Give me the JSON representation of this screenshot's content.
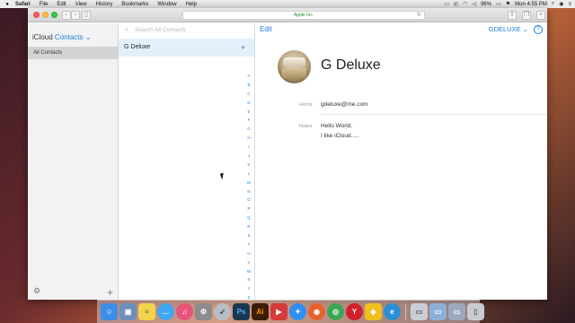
{
  "menubar": {
    "app": "Safari",
    "menus": [
      "File",
      "Edit",
      "View",
      "History",
      "Bookmarks",
      "Window",
      "Help"
    ],
    "battery": "96%",
    "clock": "Mon 4:55 PM"
  },
  "browser": {
    "url": "Apple Inc."
  },
  "sidebar": {
    "app_name_prefix": "iCloud",
    "app_name": "Contacts",
    "group": "All Contacts"
  },
  "list": {
    "search_placeholder": "Search All Contacts",
    "contacts": [
      {
        "name": "G Deluxe"
      }
    ],
    "index": [
      "A",
      "B",
      "C",
      "D",
      "E",
      "F",
      "G",
      "H",
      "I",
      "J",
      "K",
      "L",
      "M",
      "N",
      "O",
      "P",
      "Q",
      "R",
      "S",
      "T",
      "U",
      "V",
      "W",
      "X",
      "Y",
      "Z",
      "#"
    ]
  },
  "detail": {
    "edit_label": "Edit",
    "account": "GDELUXE",
    "help": "?",
    "name": "G Deluxe",
    "fields": [
      {
        "label": "Home",
        "value": "gdeluxe@me.com"
      },
      {
        "label": "Notes",
        "value": "Hello World."
      },
      {
        "label": "",
        "value": "I like iCloud....."
      }
    ]
  },
  "dock": {
    "apps": [
      {
        "icon": "finder-icon",
        "glyph": "☺",
        "color": "#3d8ee8"
      },
      {
        "icon": "preview-icon",
        "glyph": "▣",
        "color": "#6f8fb8"
      },
      {
        "icon": "notes-icon",
        "glyph": "≡",
        "color": "#f3d44e"
      },
      {
        "icon": "messages-icon",
        "glyph": "…",
        "color": "#3fa6f0"
      },
      {
        "icon": "itunes-icon",
        "glyph": "♫",
        "color": "#e9547a"
      },
      {
        "icon": "system-preferences-icon",
        "glyph": "⚙",
        "color": "#8c8c8c"
      },
      {
        "icon": "launchpad-icon",
        "glyph": "➶",
        "color": "#b9bec6"
      },
      {
        "icon": "photoshop-icon",
        "glyph": "Ps",
        "color": "#1b3651"
      },
      {
        "icon": "illustrator-icon",
        "glyph": "Ai",
        "color": "#ff7c00"
      },
      {
        "icon": "video-player-icon",
        "glyph": "▶",
        "color": "#d63a3a"
      },
      {
        "icon": "safari-icon",
        "glyph": "✦",
        "color": "#2e8ff0"
      },
      {
        "icon": "firefox-icon",
        "glyph": "◉",
        "color": "#e8612c"
      },
      {
        "icon": "chrome-icon",
        "glyph": "◎",
        "color": "#3aa757"
      },
      {
        "icon": "yandex-icon",
        "glyph": "Y",
        "color": "#d21f2d"
      },
      {
        "icon": "duck-icon",
        "glyph": "◆",
        "color": "#f0c020"
      },
      {
        "icon": "edge-icon",
        "glyph": "e",
        "color": "#2a8fd6"
      },
      {
        "icon": "downloads-icon",
        "glyph": "▭",
        "color": "#c9ced6"
      },
      {
        "icon": "desktop-icon",
        "glyph": "▭",
        "color": "#8ab0d8"
      },
      {
        "icon": "documents-icon",
        "glyph": "▭",
        "color": "#9aa9bd"
      },
      {
        "icon": "trash-icon",
        "glyph": "▯",
        "color": "#c8ccd2"
      }
    ]
  }
}
